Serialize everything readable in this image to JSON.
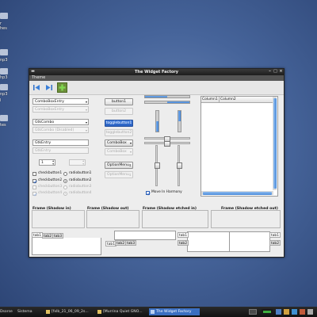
{
  "desktop": {
    "labels": [
      "r",
      "hes",
      "np3",
      "hp3",
      "np3",
      "l",
      "tes"
    ],
    "taskbar": {
      "menus": [
        "Dsorse",
        "Sistema"
      ],
      "tasks": [
        "[fxlb_21_06_09_2s...",
        "[Murrina Quiet GNO...",
        "The Widget Factory"
      ]
    }
  },
  "window": {
    "title": "The Widget Factory",
    "menu": [
      "Theme"
    ],
    "toolbar_icons": [
      "go-first-icon",
      "go-last-icon",
      "add-icon"
    ]
  },
  "left_column": {
    "combo_entry_1": "ComboBoxEntry",
    "combo_entry_2": "ComboBoxEntry",
    "gtk_combo_1": "GtkCombo",
    "gtk_combo_2": "GtkCombo (Disabled)",
    "gtk_entry_1": "GtkEntry",
    "gtk_entry_2": "GtkEntry",
    "spin_1": "1",
    "spin_2": "",
    "checks": [
      {
        "check": "checkbutton1",
        "radio": "radiobutton1",
        "checked": false,
        "radio_on": false,
        "disabled": false
      },
      {
        "check": "checkbutton2",
        "radio": "radiobutton2",
        "checked": true,
        "radio_on": true,
        "disabled": false
      },
      {
        "check": "checkbutton3",
        "radio": "radiobutton3",
        "checked": false,
        "radio_on": false,
        "disabled": true
      },
      {
        "check": "checkbutton4",
        "radio": "radiobutton4",
        "checked": true,
        "radio_on": true,
        "disabled": true
      }
    ]
  },
  "middle_column": {
    "button1": "button1",
    "button2": "button2",
    "togglebutton1": "togglebutton1",
    "togglebutton2": "togglebutton2",
    "combobox1": "ComboBox",
    "combobox2": "ComboBox",
    "optionmenu1": "OptionMenu",
    "optionmenu2": "OptionMenu"
  },
  "sliders": {
    "move_in_harmony": "Move In Harmony",
    "move_in_harmony_checked": true,
    "hprogress_1": 0.5,
    "hprogress_2": 0.5,
    "vprogress_1": 0.5,
    "vprogress_2": 0.5,
    "hscale_1": 0.5,
    "hscale_2": 0.5,
    "vscale_1": 0.5,
    "vscale_2": 0.5
  },
  "tree": {
    "columns": [
      "Column1",
      "Column2"
    ]
  },
  "frames": [
    "Frame (Shadow in)",
    "Frame (Shadow out)",
    "Frame (Shadow etched in)",
    "Frame (Shadow etched out)"
  ],
  "notebooks": {
    "nb1": [
      "tab1",
      "tab2",
      "tab3"
    ],
    "nb2": [
      "tab1",
      "tab2",
      "tab3"
    ],
    "nb3": [
      "tab1",
      "tab2"
    ],
    "nb4": [
      "tab1",
      "tab2"
    ]
  }
}
